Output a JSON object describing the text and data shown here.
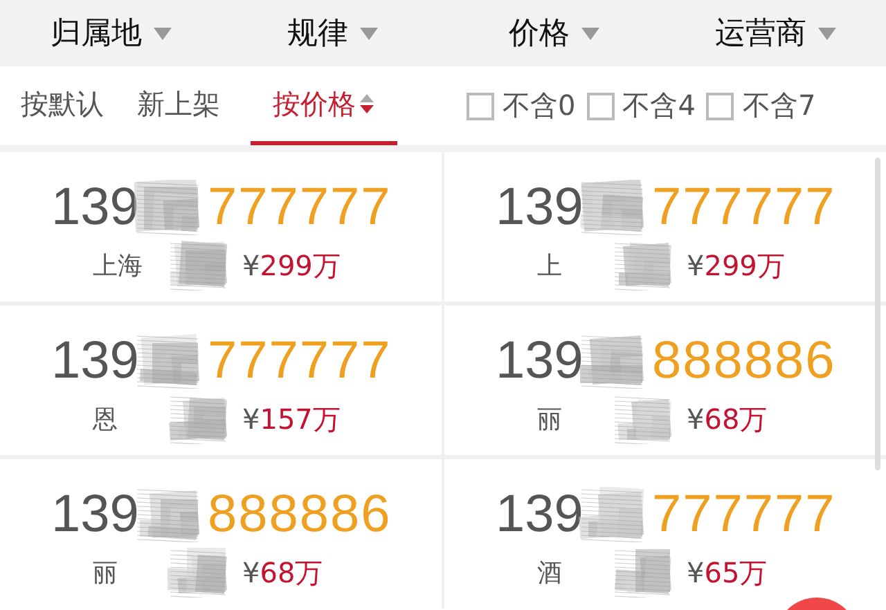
{
  "filters": [
    {
      "label": "归属地"
    },
    {
      "label": "规律"
    },
    {
      "label": "价格"
    },
    {
      "label": "运营商"
    }
  ],
  "sort_tabs": [
    {
      "label": "按默认",
      "selected": false
    },
    {
      "label": "新上架",
      "selected": false
    },
    {
      "label": "按价格",
      "selected": true
    }
  ],
  "options": [
    {
      "label": "不含0",
      "checked": false
    },
    {
      "label": "不含4",
      "checked": false
    },
    {
      "label": "不含7",
      "checked": false
    }
  ],
  "listings": [
    {
      "prefix": "139",
      "suffix": "777777",
      "location": "上海",
      "currency": "¥",
      "price": "299万"
    },
    {
      "prefix": "139",
      "suffix": "777777",
      "location": "上",
      "currency": "¥",
      "price": "299万"
    },
    {
      "prefix": "139",
      "suffix": "777777",
      "location": "恩",
      "currency": "¥",
      "price": "157万"
    },
    {
      "prefix": "139",
      "suffix": "888886",
      "location": "丽",
      "currency": "¥",
      "price": "68万"
    },
    {
      "prefix": "139",
      "suffix": "888886",
      "location": "丽",
      "currency": "¥",
      "price": "68万"
    },
    {
      "prefix": "139",
      "suffix": "777777",
      "location": "酒",
      "currency": "¥",
      "price": "65万"
    }
  ]
}
